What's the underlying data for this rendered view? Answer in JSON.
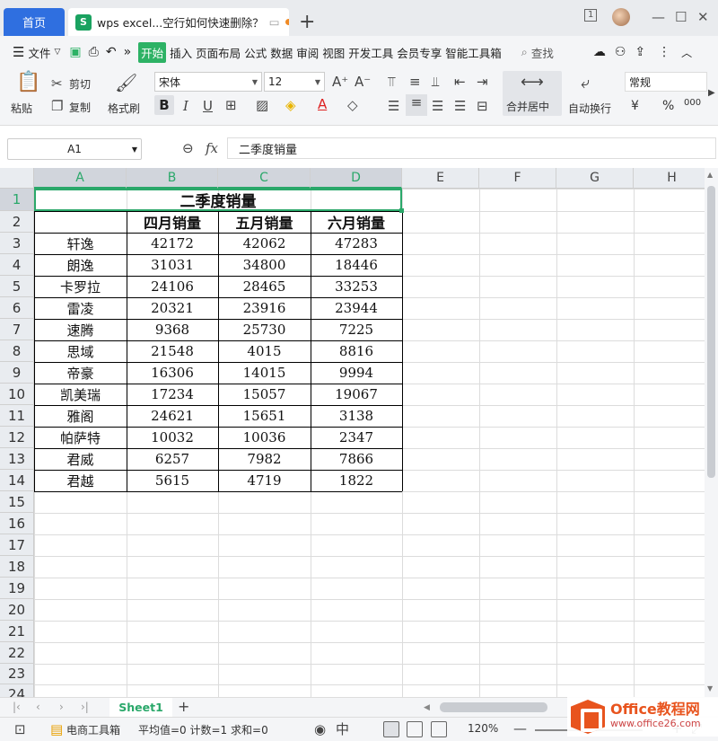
{
  "titlebar": {
    "home_tab": "首页",
    "doc_tab": "wps excel...空行如何快速删除？",
    "new_tab": "+",
    "badge": "1"
  },
  "menubar": {
    "file": "文件",
    "tabs": [
      "开始",
      "插入",
      "页面布局",
      "公式",
      "数据",
      "审阅",
      "视图",
      "开发工具",
      "会员专享",
      "智能工具箱"
    ],
    "search": "查找"
  },
  "ribbon": {
    "paste": "粘贴",
    "cut": "剪切",
    "copy": "复制",
    "format_painter": "格式刷",
    "font_name": "宋体",
    "font_size": "12",
    "merge": "合并居中",
    "wrap": "自动换行",
    "number_format": "常规",
    "currency": "¥",
    "percent": "%",
    "thousands": "000"
  },
  "formulabar": {
    "cell_ref": "A1",
    "fx": "fx",
    "content": "二季度销量"
  },
  "grid": {
    "columns": [
      "A",
      "B",
      "C",
      "D",
      "E",
      "F",
      "G",
      "H"
    ],
    "rows": [
      "1",
      "2",
      "3",
      "4",
      "5",
      "6",
      "7",
      "8",
      "9",
      "10",
      "11",
      "12",
      "13",
      "14",
      "15",
      "16",
      "17",
      "18",
      "19",
      "20",
      "21",
      "22",
      "23",
      "24"
    ],
    "title": "二季度销量",
    "headers": [
      "",
      "四月销量",
      "五月销量",
      "六月销量"
    ],
    "data": [
      [
        "轩逸",
        "42172",
        "42062",
        "47283"
      ],
      [
        "朗逸",
        "31031",
        "34800",
        "18446"
      ],
      [
        "卡罗拉",
        "24106",
        "28465",
        "33253"
      ],
      [
        "雷凌",
        "20321",
        "23916",
        "23944"
      ],
      [
        "速腾",
        "9368",
        "25730",
        "7225"
      ],
      [
        "思域",
        "21548",
        "4015",
        "8816"
      ],
      [
        "帝豪",
        "16306",
        "14015",
        "9994"
      ],
      [
        "凯美瑞",
        "17234",
        "15057",
        "19067"
      ],
      [
        "雅阁",
        "24621",
        "15651",
        "3138"
      ],
      [
        "帕萨特",
        "10032",
        "10036",
        "2347"
      ],
      [
        "君威",
        "6257",
        "7982",
        "7866"
      ],
      [
        "君越",
        "5615",
        "4719",
        "1822"
      ]
    ]
  },
  "sheets": [
    "Sheet1"
  ],
  "statusbar": {
    "tool": "电商工具箱",
    "stats": "平均值=0  计数=1  求和=0",
    "zoom": "120%"
  },
  "watermark": {
    "line1": "Office教程网",
    "line2": "www.office26.com"
  },
  "colors": {
    "accent": "#2aa86a",
    "home_tab": "#2f6fe0",
    "watermark": "#e8541e"
  }
}
